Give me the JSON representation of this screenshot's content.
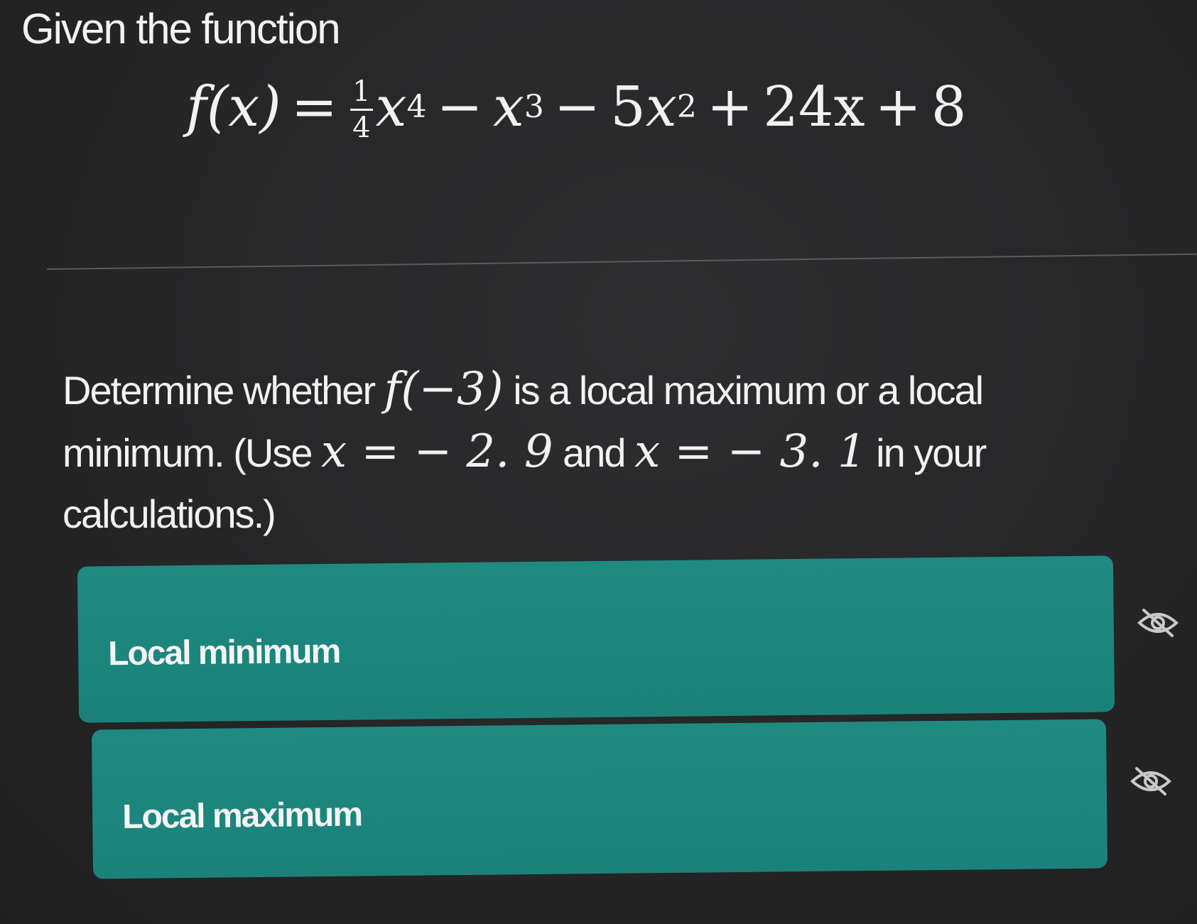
{
  "question": {
    "intro": "Given the function",
    "formula": {
      "lhs": "f(x)",
      "equals": "=",
      "frac_num": "1",
      "frac_den": "4",
      "t1_base": "x",
      "t1_exp": "4",
      "op1": "−",
      "t2_base": "x",
      "t2_exp": "3",
      "op2": "−",
      "t3_coef": "5",
      "t3_base": "x",
      "t3_exp": "2",
      "op3": "+",
      "t4": "24x",
      "op4": "+",
      "t5": "8"
    },
    "prompt": {
      "p1": "Determine whether ",
      "m1": "f(−3)",
      "p2": " is a local maximum or a local minimum. (Use ",
      "m2": "x = − 2. 9",
      "p3": " and ",
      "m3": "x = − 3. 1",
      "p4": " in your calculations.)"
    }
  },
  "options": [
    {
      "label": "Local minimum"
    },
    {
      "label": "Local maximum"
    }
  ],
  "colors": {
    "background": "#262627",
    "option_fill": "#1e8a82",
    "text": "#f2f2f2"
  },
  "icons": {
    "option_toggle": "eye-slash-icon"
  }
}
